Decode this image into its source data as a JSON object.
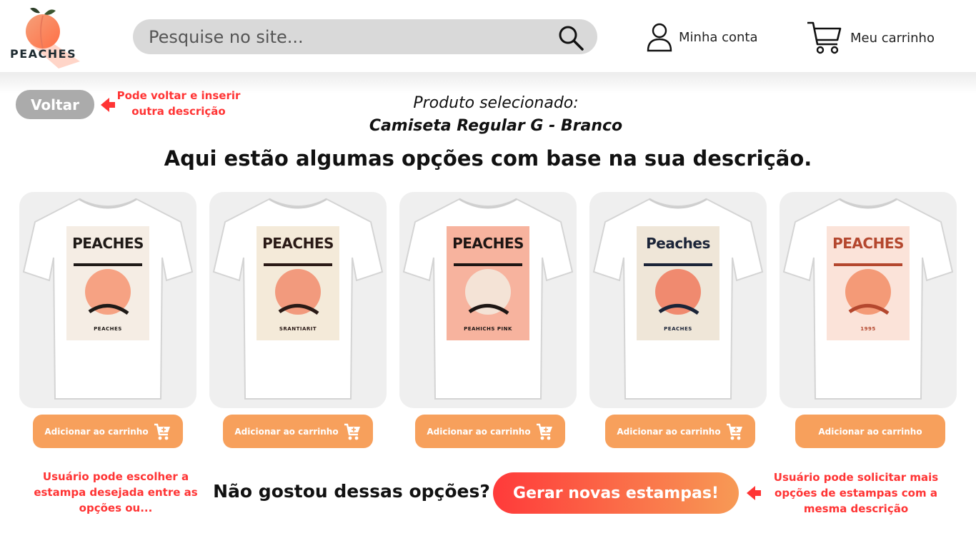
{
  "header": {
    "logo_text": "PEACHES",
    "search_placeholder": "Pesquise no site...",
    "account_label": "Minha conta",
    "cart_label": "Meu carrinho"
  },
  "back": {
    "label": "Voltar",
    "note": "Pode voltar e inserir outra descrição"
  },
  "selection": {
    "label": "Produto selecionado:",
    "product": "Camiseta Regular G - Branco"
  },
  "headline": "Aqui estão algumas opções com base na sua descrição.",
  "products": [
    {
      "design_title": "PEACHES",
      "design_caption": "PEACHES",
      "add_label": "Adicionar ao carrinho",
      "show_cart_icon": true
    },
    {
      "design_title": "PEACHES",
      "design_caption": "SRANTIARIT",
      "add_label": "Adicionar ao carrinho",
      "show_cart_icon": true
    },
    {
      "design_title": "PEACHES",
      "design_caption": "PEAHICHS PINK",
      "add_label": "Adicionar ao carrinho",
      "show_cart_icon": true
    },
    {
      "design_title": "Peaches",
      "design_caption": "PEACHES",
      "add_label": "Adicionar ao carrinho",
      "show_cart_icon": true
    },
    {
      "design_title": "PEACHES",
      "design_caption": "1995",
      "add_label": "Adicionar ao carrinho",
      "show_cart_icon": false
    }
  ],
  "footer": {
    "left_note": "Usuário pode escolher a estampa desejada entre as opções ou...",
    "question": "Não gostou dessas opções?",
    "generate_label": "Gerar novas estampas!",
    "right_note": "Usuário pode solicitar mais opções de estampas com a mesma descrição"
  },
  "colors": {
    "accent_orange": "#f7a05c",
    "note_red": "#ff3434",
    "peach": "#f6a283"
  },
  "icons": [
    "search-icon",
    "user-icon",
    "cart-icon",
    "arrow-left-icon"
  ]
}
